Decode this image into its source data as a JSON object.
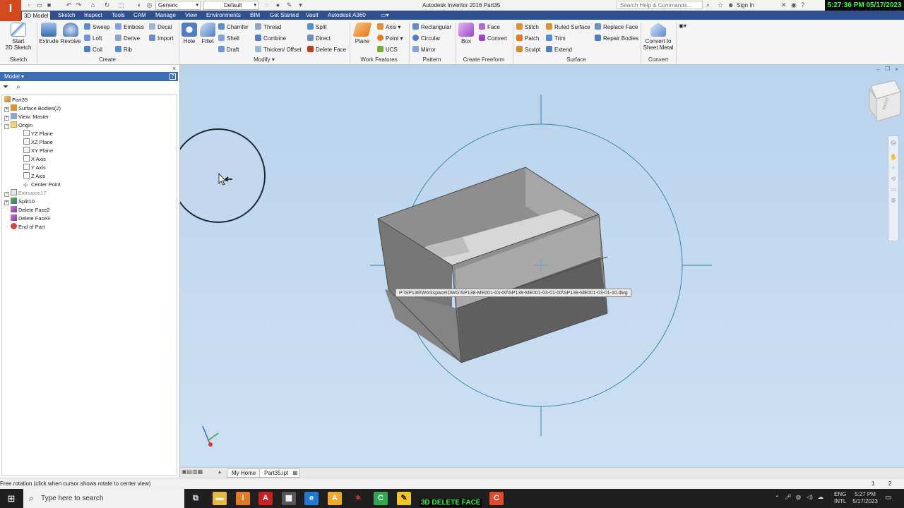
{
  "app": {
    "logo": "I",
    "window_title": "Autodesk Inventor 2016    Part35",
    "search_placeholder": "Search Help & Commands...",
    "sign_in": "Sign In",
    "clock_overlay": "5:27:36 PM 05/17/2023",
    "qat": {
      "material": "Generic",
      "appearance": "Default"
    }
  },
  "tabs": [
    {
      "label": "3D Model",
      "active": true
    },
    {
      "label": "Sketch"
    },
    {
      "label": "Inspect"
    },
    {
      "label": "Tools"
    },
    {
      "label": "CAM"
    },
    {
      "label": "Manage"
    },
    {
      "label": "View"
    },
    {
      "label": "Environments"
    },
    {
      "label": "BIM"
    },
    {
      "label": "Get Started"
    },
    {
      "label": "Vault"
    },
    {
      "label": "Autodesk A360"
    }
  ],
  "ribbon": {
    "sketch": {
      "label": "Sketch",
      "start_sketch": [
        "Start",
        "2D Sketch"
      ]
    },
    "create": {
      "label": "Create",
      "extrude": "Extrude",
      "revolve": "Revolve",
      "sweep": "Sweep",
      "loft": "Loft",
      "coil": "Coil",
      "emboss": "Emboss",
      "derive": "Derive",
      "rib": "Rib",
      "decal": "Decal",
      "import": "Import"
    },
    "modify": {
      "label": "Modify ▾",
      "hole": "Hole",
      "fillet": "Fillet",
      "chamfer": "Chamfer",
      "shell": "Shell",
      "draft": "Draft",
      "thread": "Thread",
      "combine": "Combine",
      "thicken": "Thicken/ Offset",
      "split": "Split",
      "direct": "Direct",
      "delete_face": "Delete Face"
    },
    "work_features": {
      "label": "Work Features",
      "plane": "Plane",
      "axis": "Axis",
      "point": "Point",
      "ucs": "UCS"
    },
    "pattern": {
      "label": "Pattern",
      "rectangular": "Rectangular",
      "circular": "Circular",
      "mirror": "Mirror"
    },
    "freeform": {
      "label": "Create Freeform",
      "box": "Box",
      "face": "Face",
      "convert": "Convert"
    },
    "surface": {
      "label": "Surface",
      "stitch": "Stitch",
      "patch": "Patch",
      "sculpt": "Sculpt",
      "ruled_surface": "Ruled Surface",
      "trim": "Trim",
      "extend": "Extend",
      "replace_face": "Replace Face",
      "repair_bodies": "Repair Bodies"
    },
    "convert": {
      "label": "Convert",
      "sheet_metal": [
        "Convert to",
        "Sheet Metal"
      ]
    }
  },
  "browser": {
    "title": "Model ▾",
    "tree": [
      {
        "label": "Part35",
        "level": 0,
        "icon": "part-icon"
      },
      {
        "label": "Surface Bodies(2)",
        "level": 1,
        "icon": "surface-bodies-icon",
        "expander": "+"
      },
      {
        "label": "View: Master",
        "level": 1,
        "icon": "view-icon",
        "expander": "+"
      },
      {
        "label": "Origin",
        "level": 1,
        "icon": "folder-icon",
        "expander": "-"
      },
      {
        "label": "YZ Plane",
        "level": 2,
        "icon": "plane-icon"
      },
      {
        "label": "XZ Plane",
        "level": 2,
        "icon": "plane-icon"
      },
      {
        "label": "XY Plane",
        "level": 2,
        "icon": "plane-icon"
      },
      {
        "label": "X Axis",
        "level": 2,
        "icon": "axis-icon"
      },
      {
        "label": "Y Axis",
        "level": 2,
        "icon": "axis-icon"
      },
      {
        "label": "Z Axis",
        "level": 2,
        "icon": "axis-icon"
      },
      {
        "label": "Center Point",
        "level": 2,
        "icon": "point-icon"
      },
      {
        "label": "Extrusion17",
        "level": 1,
        "icon": "extrusion-icon",
        "expander": "+",
        "dim": true
      },
      {
        "label": "Split10",
        "level": 1,
        "icon": "split-icon",
        "expander": "+"
      },
      {
        "label": "Delete Face2",
        "level": 1,
        "icon": "delete-face-icon"
      },
      {
        "label": "Delete Face3",
        "level": 1,
        "icon": "delete-face-icon"
      },
      {
        "label": "End of Part",
        "level": 1,
        "icon": "end-of-part-icon"
      }
    ]
  },
  "viewport": {
    "tooltip": "P:\\SP138\\Workspace\\DWG\\SP138-ME001-03-00\\SP138-ME001-03-01-00\\SP138-ME001-03-01-10.dwg",
    "viewcube_face": "RIGHT"
  },
  "doc_tabs": {
    "home": "My Home",
    "part": "Part35.ipt"
  },
  "status": {
    "message": "Free rotation (click when cursor shows rotate to center view)",
    "count1": "1",
    "count2": "2"
  },
  "taskbar": {
    "search_placeholder": "Type here to search",
    "overlay_label": "3D DELETE FACE",
    "lang": [
      "ENG",
      "INTL"
    ],
    "time": "5:27 PM",
    "date": "5/17/2023"
  },
  "colors": {
    "ribbon_tab_bar": "#2f4f8f",
    "browser_header": "#3c6eb5",
    "viewport_bg": "#c6dbf0",
    "app_logo": "#d24b1f"
  }
}
